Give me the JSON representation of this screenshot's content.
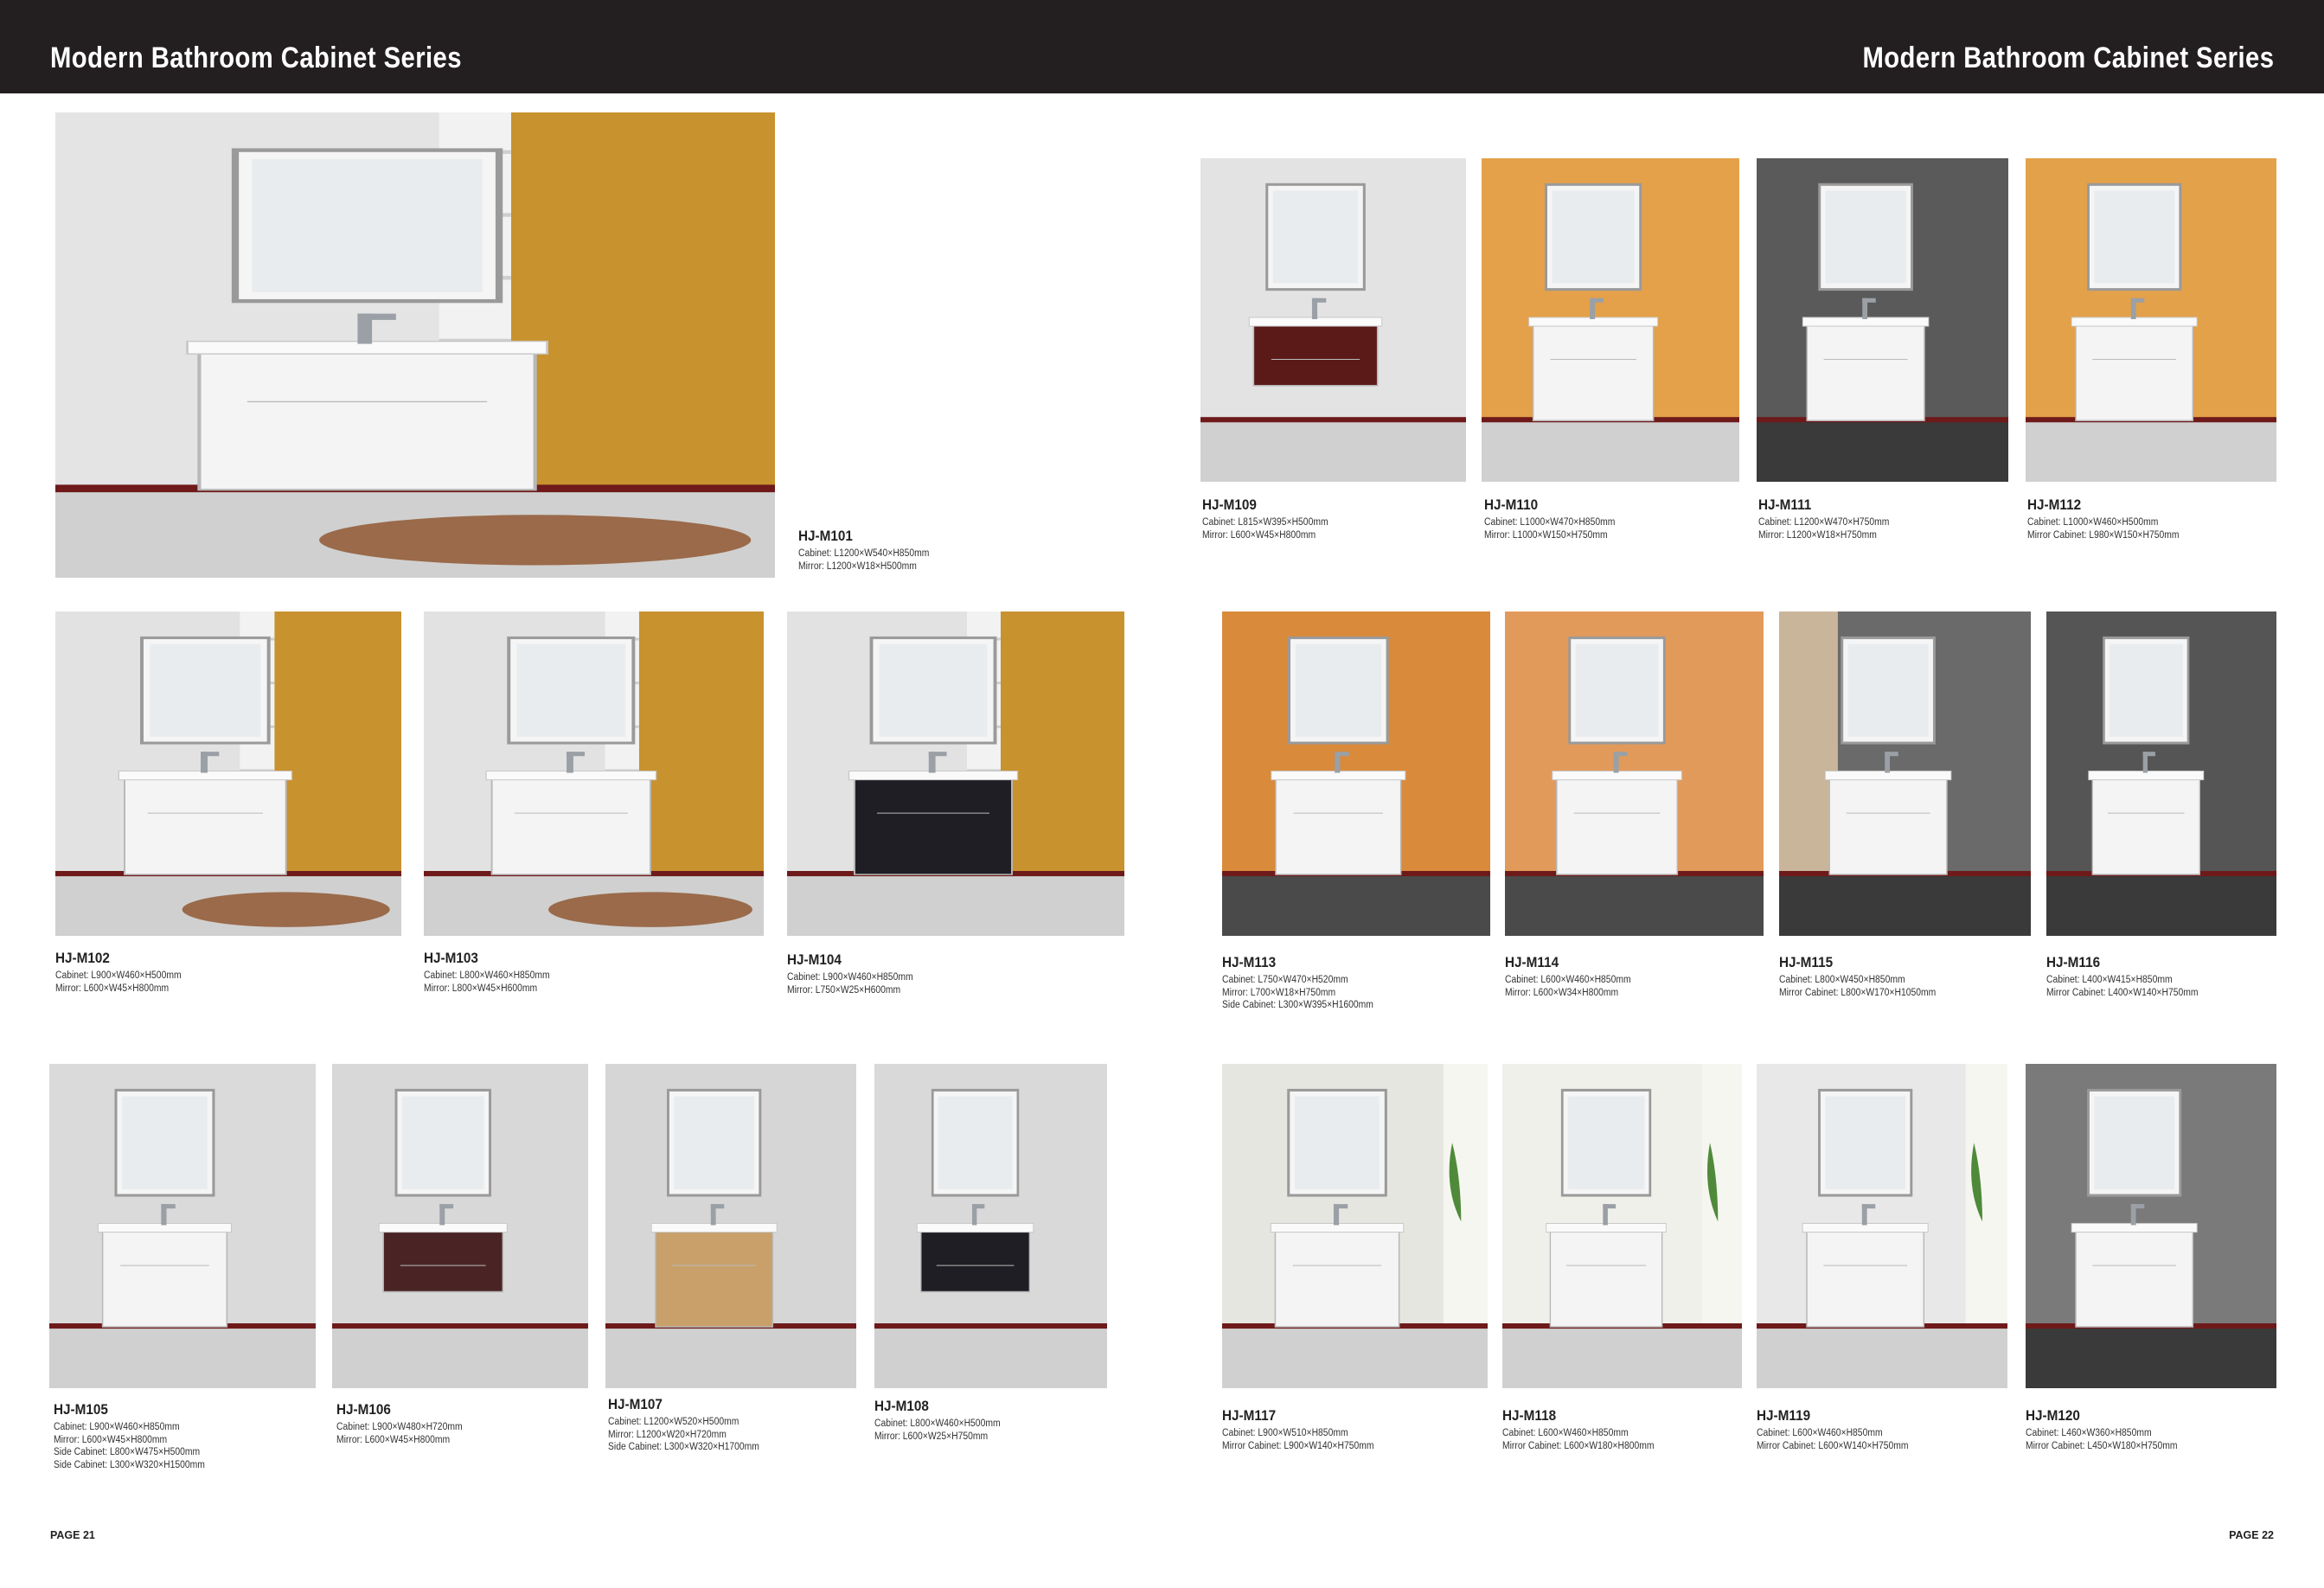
{
  "header": {
    "left_title": "Modern Bathroom Cabinet Series",
    "right_title": "Modern Bathroom Cabinet Series"
  },
  "products": [
    {
      "code": "HJ-M101",
      "specs": [
        "Cabinet: L1200×W540×H850mm",
        "Mirror: L1200×W18×H500mm"
      ]
    },
    {
      "code": "HJ-M102",
      "specs": [
        "Cabinet: L900×W460×H500mm",
        "Mirror: L600×W45×H800mm"
      ]
    },
    {
      "code": "HJ-M103",
      "specs": [
        "Cabinet: L800×W460×H850mm",
        "Mirror: L800×W45×H600mm"
      ]
    },
    {
      "code": "HJ-M104",
      "specs": [
        "Cabinet: L900×W460×H850mm",
        "Mirror: L750×W25×H600mm"
      ]
    },
    {
      "code": "HJ-M105",
      "specs": [
        "Cabinet: L900×W460×H850mm",
        "Mirror: L600×W45×H800mm",
        "Side Cabinet: L800×W475×H500mm",
        "Side Cabinet: L300×W320×H1500mm"
      ]
    },
    {
      "code": "HJ-M106",
      "specs": [
        "Cabinet: L900×W480×H720mm",
        "Mirror: L600×W45×H800mm"
      ]
    },
    {
      "code": "HJ-M107",
      "specs": [
        "Cabinet: L1200×W520×H500mm",
        "Mirror: L1200×W20×H720mm",
        "Side Cabinet: L300×W320×H1700mm"
      ]
    },
    {
      "code": "HJ-M108",
      "specs": [
        "Cabinet: L800×W460×H500mm",
        "Mirror: L600×W25×H750mm"
      ]
    },
    {
      "code": "HJ-M109",
      "specs": [
        "Cabinet: L815×W395×H500mm",
        "Mirror: L600×W45×H800mm"
      ]
    },
    {
      "code": "HJ-M110",
      "specs": [
        "Cabinet: L1000×W470×H850mm",
        "Mirror: L1000×W150×H750mm"
      ]
    },
    {
      "code": "HJ-M111",
      "specs": [
        "Cabinet: L1200×W470×H750mm",
        "Mirror: L1200×W18×H750mm"
      ]
    },
    {
      "code": "HJ-M112",
      "specs": [
        "Cabinet: L1000×W460×H500mm",
        "Mirror Cabinet: L980×W150×H750mm"
      ]
    },
    {
      "code": "HJ-M113",
      "specs": [
        "Cabinet: L750×W470×H520mm",
        "Mirror: L700×W18×H750mm",
        "Side Cabinet: L300×W395×H1600mm"
      ]
    },
    {
      "code": "HJ-M114",
      "specs": [
        "Cabinet: L600×W460×H850mm",
        "Mirror: L600×W34×H800mm"
      ]
    },
    {
      "code": "HJ-M115",
      "specs": [
        "Cabinet: L800×W450×H850mm",
        "Mirror Cabinet: L800×W170×H1050mm"
      ]
    },
    {
      "code": "HJ-M116",
      "specs": [
        "Cabinet: L400×W415×H850mm",
        "Mirror Cabinet: L400×W140×H750mm"
      ]
    },
    {
      "code": "HJ-M117",
      "specs": [
        "Cabinet: L900×W510×H850mm",
        "Mirror Cabinet: L900×W140×H750mm"
      ]
    },
    {
      "code": "HJ-M118",
      "specs": [
        "Cabinet: L600×W460×H850mm",
        "Mirror Cabinet: L600×W180×H800mm"
      ]
    },
    {
      "code": "HJ-M119",
      "specs": [
        "Cabinet: L600×W460×H850mm",
        "Mirror Cabinet: L600×W140×H750mm"
      ]
    },
    {
      "code": "HJ-M120",
      "specs": [
        "Cabinet: L460×W360×H850mm",
        "Mirror Cabinet: L450×W180×H750mm"
      ]
    }
  ],
  "pages": {
    "left": "PAGE 21",
    "right": "PAGE 22"
  },
  "colors": {
    "header_bg": "#231f20",
    "header_text": "#ffffff",
    "wall_grey": "#dcdcdc",
    "wall_orange": "#d98a2b",
    "floor_red": "#7a1b1b"
  }
}
